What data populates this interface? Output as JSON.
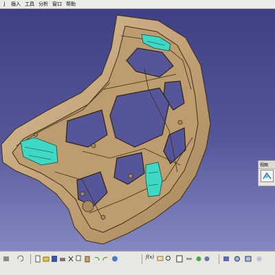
{
  "menubar": {
    "items": [
      "插入",
      "工具",
      "分析",
      "窗口",
      "帮助"
    ]
  },
  "panel": {
    "title": "视图"
  },
  "toolbar": {
    "font_tool_label": "f(x)"
  },
  "icons": {
    "panel_button": "view-icon",
    "toolbar": [
      "tool-icon",
      "undo-icon",
      "new-icon",
      "open-icon",
      "save-icon",
      "print-icon",
      "cut-icon",
      "copy-icon",
      "paste-icon",
      "undo-icon",
      "redo-icon",
      "help-icon",
      "formula-icon",
      "comment-icon",
      "search-icon",
      "table-icon",
      "measure-icon",
      "color-icon",
      "render-icon",
      "view-icon",
      "zoom-icon",
      "fit-icon"
    ]
  },
  "colors": {
    "background_top": "#3d3f82",
    "background_bottom": "#8f94c9",
    "part_fill": "#c7a97e",
    "part_edge": "#3a2c16",
    "highlight": "#3fd8c4"
  }
}
